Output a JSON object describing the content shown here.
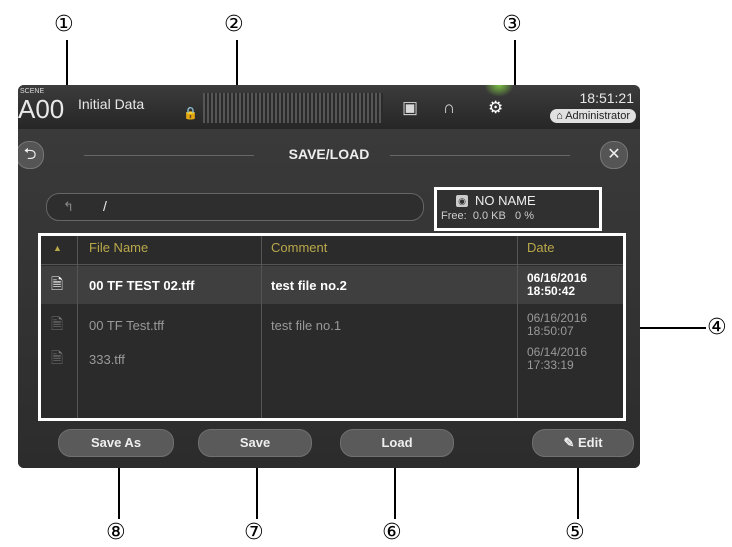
{
  "callouts": [
    "①",
    "②",
    "③",
    "④",
    "⑤",
    "⑥",
    "⑦",
    "⑧"
  ],
  "topbar": {
    "scene_label": "SCENE",
    "scene_number": "A00",
    "scene_title": "Initial Data",
    "time": "18:51:21",
    "user": "Administrator",
    "icons": [
      "lock-icon",
      "meter-icon",
      "recorder-icon",
      "headphones-icon",
      "setup-icon"
    ]
  },
  "panel": {
    "title": "SAVE/LOAD",
    "back_symbol": "⮌",
    "close_symbol": "✕",
    "path": "/",
    "media": {
      "name": "NO NAME",
      "free_label": "Free:",
      "free_value": "0.0 KB",
      "free_percent": "0 %"
    }
  },
  "table": {
    "headers": {
      "sort": "▲",
      "name": "File Name",
      "comment": "Comment",
      "date": "Date"
    },
    "rows": [
      {
        "name": "00 TF TEST 02.tff",
        "comment": "test file no.2",
        "date": "06/16/2016",
        "time": "18:50:42"
      },
      {
        "name": "00 TF Test.tff",
        "comment": "test file no.1",
        "date": "06/16/2016",
        "time": "18:50:07"
      },
      {
        "name": "333.tff",
        "comment": "",
        "date": "06/14/2016",
        "time": "17:33:19"
      }
    ]
  },
  "buttons": {
    "save_as": "Save As",
    "save": "Save",
    "load": "Load",
    "edit": "Edit"
  },
  "colors": {
    "header_text": "#b9a84a",
    "active_glow": "#7bc043"
  }
}
